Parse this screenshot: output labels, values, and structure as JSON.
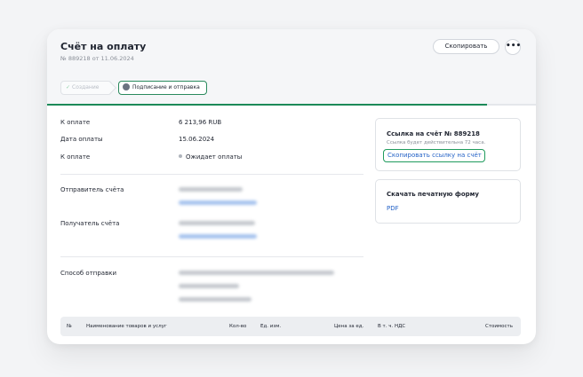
{
  "invoice": {
    "title": "Счёт на оплату",
    "subtitle": "№ 889218 от 11.06.2024"
  },
  "header_actions": {
    "copy_label": "Скопировать",
    "more_label": "•••"
  },
  "steps": [
    {
      "label": "Создание",
      "state": "done",
      "icon": "check-icon"
    },
    {
      "label": "Подписание и отправка",
      "state": "active",
      "icon": "clock-icon"
    }
  ],
  "progress": {
    "fraction": 0.9
  },
  "details": {
    "amount_label": "К оплате",
    "amount_value": "6 213,96 RUB",
    "date_label": "Дата оплаты",
    "date_value": "15.06.2024",
    "status_label": "К оплате",
    "status_value": "Ожидает оплаты",
    "sender_label": "Отправитель счёта",
    "recipient_label": "Получатель счёта",
    "delivery_label": "Способ отправки"
  },
  "link_card": {
    "title": "Ссылка на счёт № 889218",
    "note": "Ссылка будет действительна 72 часа.",
    "button_label": "Скопировать ссылку на счёт"
  },
  "print_card": {
    "title": "Скачать печатную форму",
    "link": "PDF"
  },
  "table": {
    "columns": [
      "№",
      "Наименование товаров и услуг",
      "Кол-во",
      "Ед. изм.",
      "Цена за ед.",
      "В т. ч. НДС",
      "Стоимость"
    ]
  },
  "colors": {
    "accent_green": "#1c8a58",
    "link_blue": "#2563c7"
  }
}
